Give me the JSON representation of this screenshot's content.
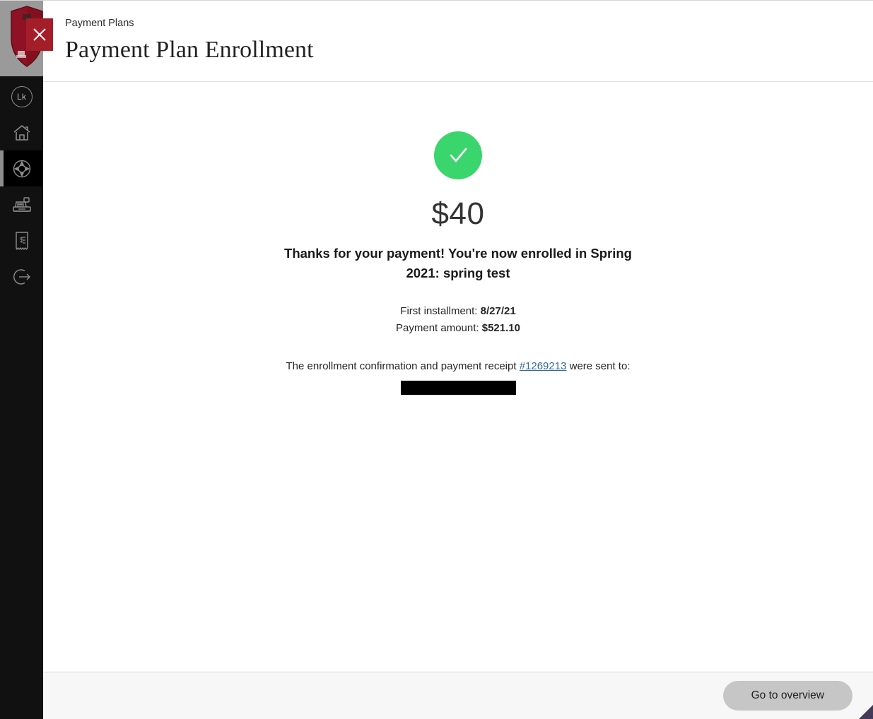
{
  "sidebar": {
    "logo": {
      "name": "institution-shield-logo",
      "color": "#8e1223"
    },
    "close_button": {
      "name": "close-icon",
      "label": "Close",
      "color": "#a41e2a"
    },
    "items": [
      {
        "id": "account",
        "label": "Lk",
        "icon": "avatar-initials-icon",
        "active": false
      },
      {
        "id": "home",
        "label": "Home",
        "icon": "home-icon",
        "active": false
      },
      {
        "id": "support",
        "label": "Payment Plans",
        "icon": "life-ring-icon",
        "active": true
      },
      {
        "id": "checkout",
        "label": "Checkout",
        "icon": "cash-register-icon",
        "active": false
      },
      {
        "id": "billing",
        "label": "Billing",
        "icon": "receipt-icon",
        "active": false
      },
      {
        "id": "signout",
        "label": "Sign out",
        "icon": "logout-icon",
        "active": false
      }
    ]
  },
  "header": {
    "breadcrumb": "Payment Plans",
    "title": "Payment Plan Enrollment"
  },
  "content": {
    "status_icon": "checkmark-icon",
    "status_color": "#3ad56d",
    "amount": "$40",
    "headline": "Thanks for your payment! You're now enrolled in Spring 2021: spring test",
    "details": [
      {
        "label": "First installment:",
        "value": "8/27/21"
      },
      {
        "label": "Payment amount:",
        "value": "$521.10"
      }
    ],
    "receipt": {
      "prefix": "The enrollment confirmation and payment receipt",
      "link_text": "#1269213",
      "link_color": "#2e6c9b",
      "suffix": "were sent to:",
      "redacted_recipient": ""
    }
  },
  "footer": {
    "primary_button": "Go to overview"
  }
}
